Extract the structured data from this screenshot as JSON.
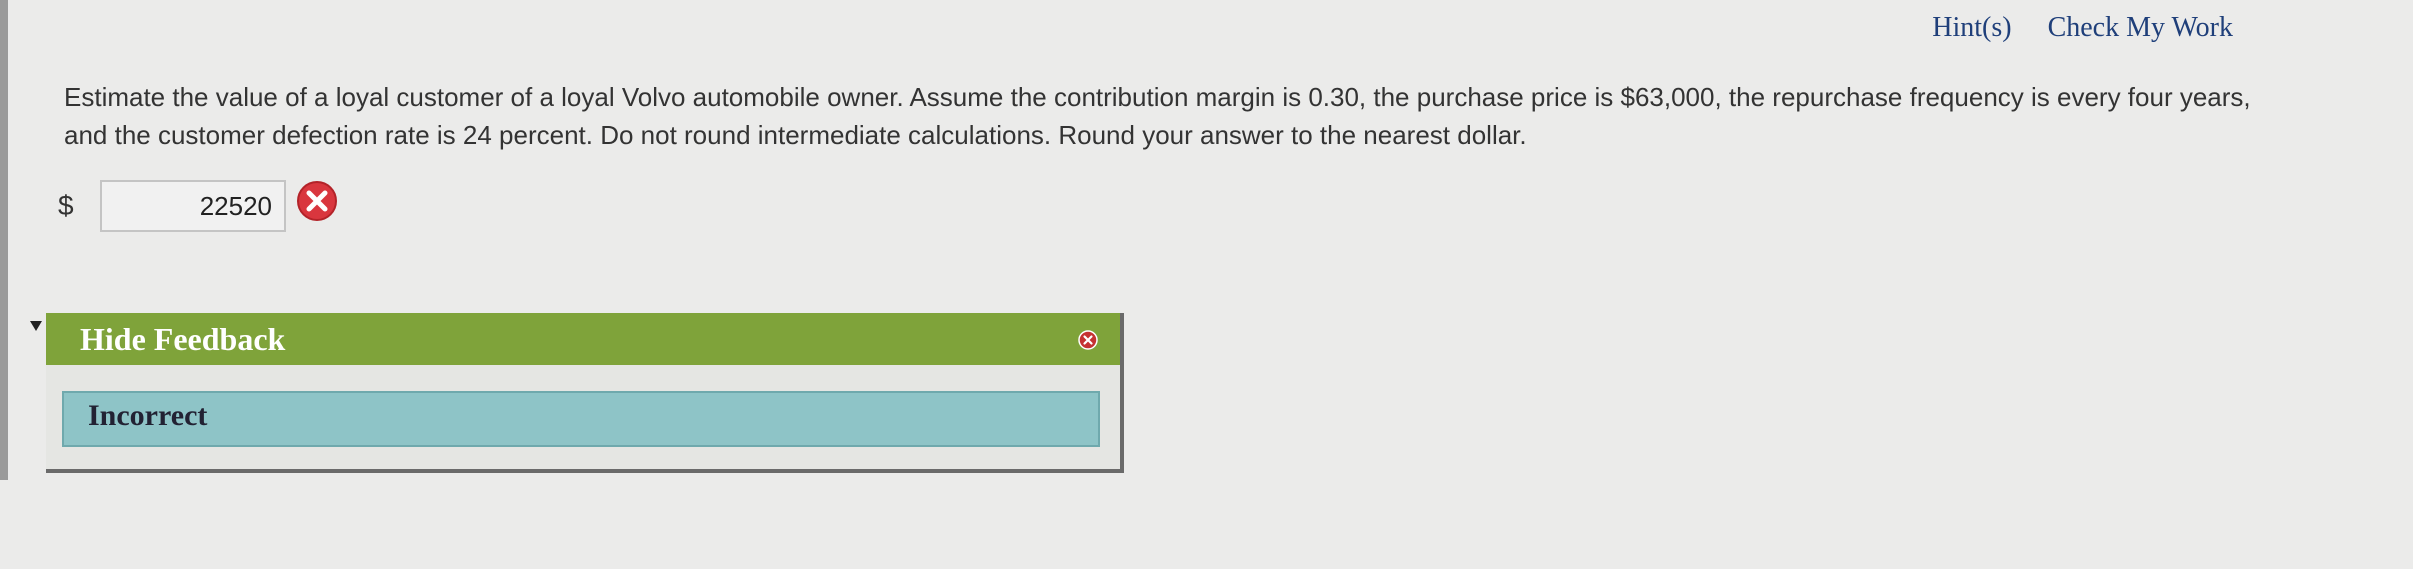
{
  "header": {
    "hints_label": "Hint(s)",
    "check_label": "Check My Work"
  },
  "question": {
    "text": "Estimate the value of a loyal customer of a loyal Volvo automobile owner. Assume the contribution margin is 0.30, the purchase price is $63,000, the repurchase frequency is every four years, and the customer defection rate is 24 percent. Do not round intermediate calculations. Round your answer to the nearest dollar."
  },
  "answer": {
    "currency": "$",
    "value": "22520",
    "status_icon": "incorrect-x-icon"
  },
  "feedback": {
    "toggle_label": "Hide Feedback",
    "result": "Incorrect",
    "close_icon": "close-icon"
  },
  "colors": {
    "feedback_bar": "#7fa33a",
    "feedback_body": "#8ec4c7",
    "link": "#1f3f7a",
    "error": "#d9363e"
  }
}
